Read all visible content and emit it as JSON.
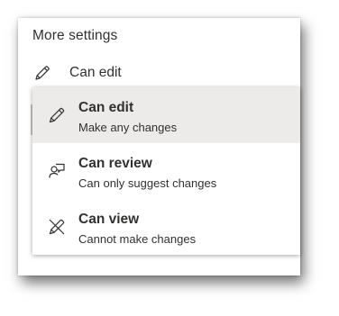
{
  "settings": {
    "title": "More settings",
    "current_permission": {
      "label": "Can edit",
      "icon": "pencil-icon"
    }
  },
  "permission_menu": {
    "items": [
      {
        "title": "Can edit",
        "description": "Make any changes",
        "icon": "pencil-icon",
        "selected": true
      },
      {
        "title": "Can review",
        "description": "Can only suggest changes",
        "icon": "review-person-icon",
        "selected": false
      },
      {
        "title": "Can view",
        "description": "Cannot make changes",
        "icon": "pencil-crossed-icon",
        "selected": false
      }
    ]
  },
  "colors": {
    "text": "#323130",
    "selected_background": "#edebe9",
    "panel_background": "#ffffff"
  }
}
